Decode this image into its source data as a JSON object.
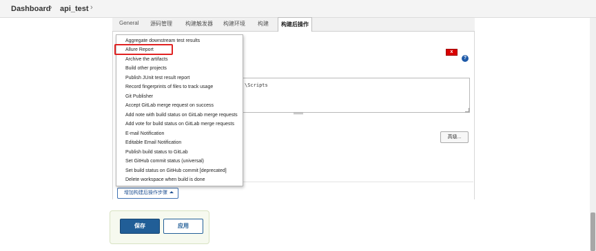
{
  "breadcrumb": {
    "items": [
      "Dashboard",
      "api_test"
    ],
    "separator": "›"
  },
  "tabs": [
    "General",
    "源码管理",
    "构建触发器",
    "构建环境",
    "构建",
    "构建后操作"
  ],
  "active_tab": "构建后操作",
  "delete_label": "x",
  "help_label": "?",
  "script_text": "\\Scripts",
  "advanced_label": "高级...",
  "add_step_label": "增加构建后操作步骤",
  "dropdown": {
    "items": [
      "Aggregate downstream test results",
      "Allure Report",
      "Archive the artifacts",
      "Build other projects",
      "Publish JUnit test result report",
      "Record fingerprints of files to track usage",
      "Git Publisher",
      "Accept GitLab merge request on success",
      "Add note with build status on GitLab merge requests",
      "Add vote for build status on GitLab merge requests",
      "E-mail Notification",
      "Editable Email Notification",
      "Publish build status to GitLab",
      "Set GitHub commit status (universal)",
      "Set build status on GitHub commit [deprecated]",
      "Delete workspace when build is done"
    ],
    "highlighted": "Allure Report"
  },
  "save_label": "保存",
  "apply_label": "应用",
  "colors": {
    "primary": "#215e97",
    "highlight": "#e02020",
    "delete": "#d90000"
  }
}
